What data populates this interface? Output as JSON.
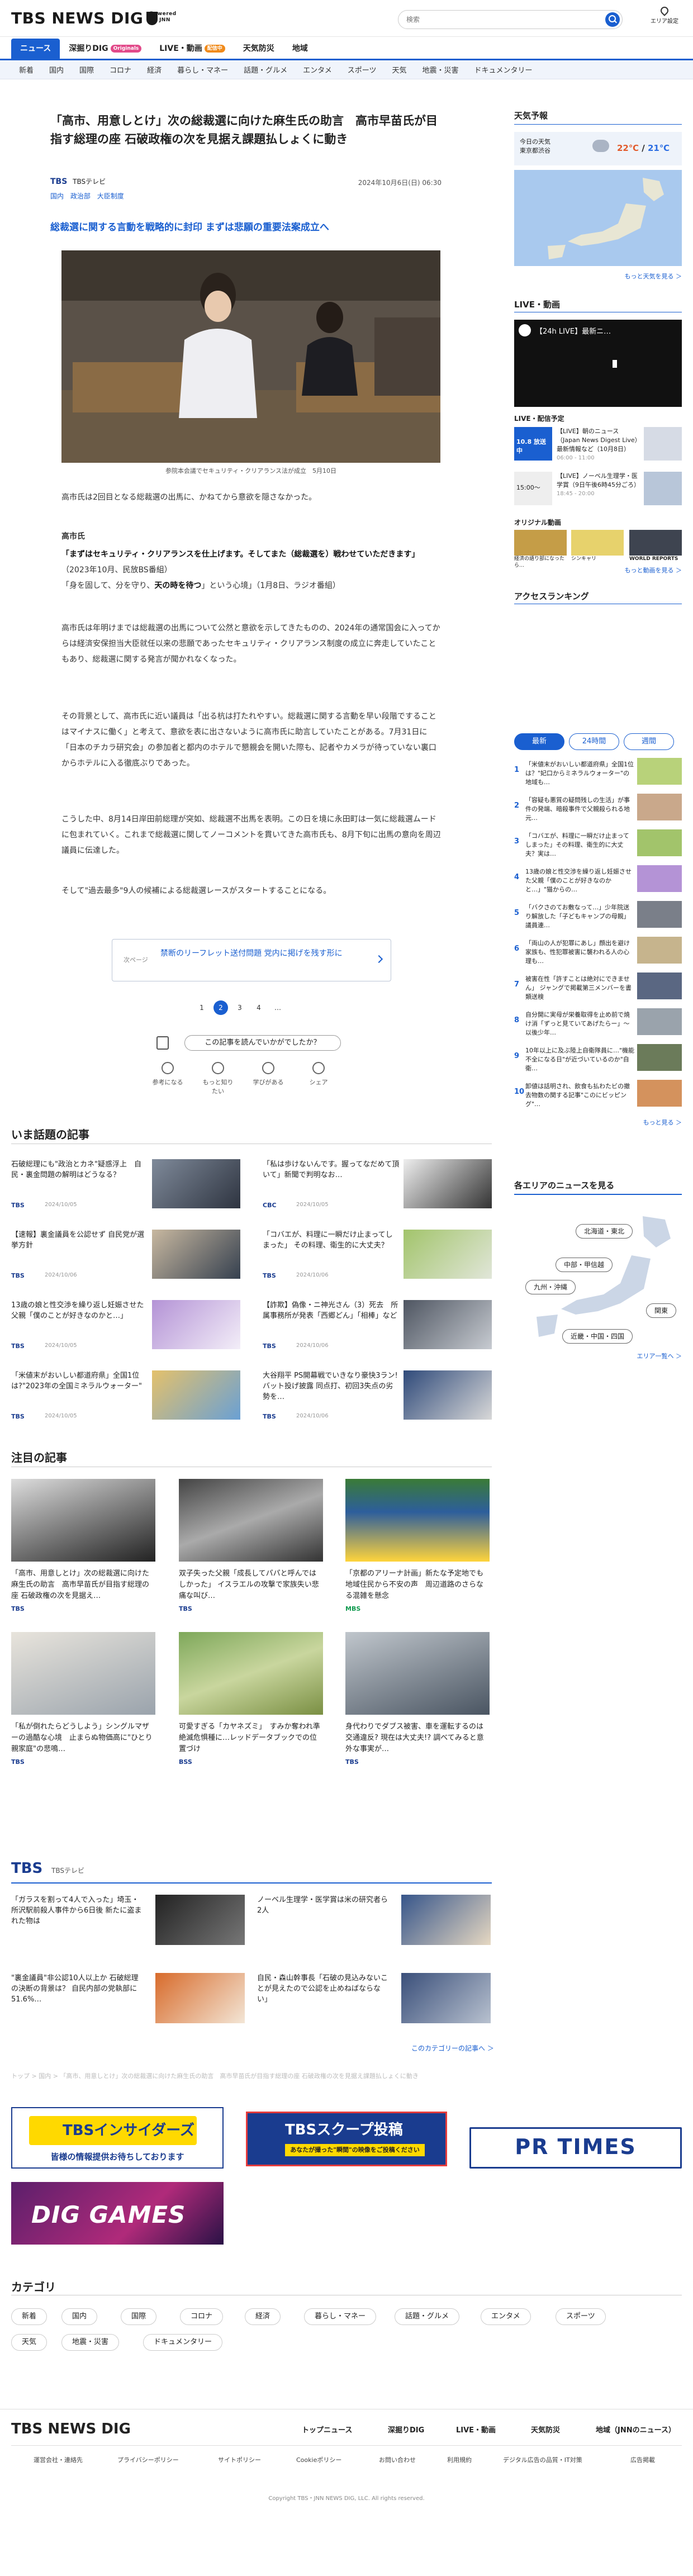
{
  "header": {
    "logo_text": "TBS NEWS DIG",
    "powered_1": "Powered",
    "powered_2": "by JNN",
    "search_placeholder": "検索",
    "area_label": "エリア設定"
  },
  "nav_primary": [
    {
      "label": "ニュース",
      "active": true
    },
    {
      "label": "深掘りDIG",
      "badge": "Originals",
      "badge_color": "#e24a8a"
    },
    {
      "label": "LIVE・動画",
      "badge": "配信中",
      "badge_color": "#f08a1a"
    },
    {
      "label": "天気防災"
    },
    {
      "label": "地域"
    }
  ],
  "nav_secondary": [
    "新着",
    "国内",
    "国際",
    "コロナ",
    "経済",
    "暮らし・マネー",
    "話題・グルメ",
    "エンタメ",
    "スポーツ",
    "天気",
    "地震・災害",
    "ドキュメンタリー"
  ],
  "article": {
    "title": "「高市、用意しとけ」次の総裁選に向けた麻生氏の助言　高市早苗氏が目指す総理の座 石破政権の次を見据え課題払しょくに動き",
    "source": "TBS",
    "source_sub": "TBSテレビ",
    "date": "2024年10月6日(日) 06:30",
    "tags": [
      "国内",
      "政治部",
      "大臣制度"
    ],
    "lead": "総裁選に関する言動を戦略的に封印 まずは悲願の重要法案成立へ",
    "caption": "参院本会議でセキュリティ・クリアランス法が成立　5月10日",
    "p1": "高市氏は2回目となる総裁選の出馬に、かねてから意欲を隠さなかった。",
    "speaker": "高市氏",
    "q1a": "「まずはセキュリティ・クリアランスを仕上げます。そしてまた（総裁選を）戦わせていただきます」",
    "q1b": "（2023年10月、民放BS番組）",
    "q2a": "「身を固して、分を守り、",
    "q2b": "天の時を待つ",
    "q2c": "」という心境」（1月8日、ラジオ番組）",
    "p3": "高市氏は年明けまでは総裁選の出馬について公然と意欲を示してきたものの、2024年の通常国会に入ってからは経済安保担当大臣就任以来の悲願であったセキュリティ・クリアランス制度の成立に奔走していたこともあり、総裁選に関する発言が聞かれなくなった。",
    "p4": "その背景として、高市氏に近い議員は「出る杭は打たれやすい。総裁選に関する言動を早い段階ですることはマイナスに働く」と考えて、意欲を表に出さないように高市氏に助言していたことがある。7月31日に「日本のチカラ研究会」の参加者と都内のホテルで懇親会を開いた際も、記者やカメラが待っていない裏口からホテルに入る徹底ぶりであった。",
    "p5": "こうした中、8月14日岸田前総理が突如、総裁選不出馬を表明。この日を境に永田町は一気に総裁選ムードに包まれていく。これまで総裁選に関してノーコメントを貫いてきた高市氏も、8月下旬に出馬の意向を周辺議員に伝達した。",
    "p6": "そして\"過去最多\"9人の候補による総裁選レースがスタートすることになる。",
    "promo_label": "次ページ",
    "promo_text": "禁断のリーフレット送付問題 党内に掲げを残す形に",
    "pages": [
      "1",
      "2",
      "3",
      "4",
      "…"
    ],
    "feedback_q": "この記事を読んでいかがでしたか？",
    "feedback_opts": [
      "参考になる",
      "もっと知りたい",
      "学びがある",
      "シェア"
    ]
  },
  "hot": {
    "title": "いま話題の記事",
    "items": [
      {
        "text": "石破総理にも\"政治とカネ\"疑惑浮上　自民・裏金問題の解明はどうなる？",
        "src": "TBS",
        "date": "2024/10/05"
      },
      {
        "text": "「私は歩けないんです。握ってなだめて頂いて」新聞で判明なお…",
        "src": "CBC",
        "date": "2024/10/05"
      },
      {
        "text": "【速報】裏金議員を公認せず 自民党が選挙方針",
        "src": "TBS",
        "date": "2024/10/06"
      },
      {
        "text": "「コバエが、料理に一瞬だけ止まってしまった」 その料理、衛生的に大丈夫？",
        "src": "TBS",
        "date": "2024/10/06"
      },
      {
        "text": "13歳の娘と性交渉を繰り返し妊娠させた父親「僕のことが好きなのかと…」",
        "src": "TBS",
        "date": "2024/10/05"
      },
      {
        "text": "【詐欺】偽像・ニ神光さん（3）死去　所属事務所が発表「西郷どん」「相棒」など",
        "src": "TBS",
        "date": "2024/10/06"
      },
      {
        "text": "「米値末がおいしい都道府県」全国1位は?\"2023年の全国ミネラルウォーター\"",
        "src": "TBS",
        "date": "2024/10/05"
      },
      {
        "text": "大谷翔平 PS開幕戦でいきなり豪快3ラン! バット投げ披露 同点打、初回3失点の劣勢を…",
        "src": "TBS",
        "date": "2024/10/06"
      }
    ]
  },
  "featured": {
    "title": "注目の記事",
    "items": [
      {
        "text": "「高市、用意しとけ」次の総裁選に向けた麻生氏の助言　高市早苗氏が目指す総理の座 石破政権の次を見据え…",
        "src": "TBS"
      },
      {
        "text": "双子失った父親「成長してパパと呼んではしかった」 イスラエルの攻撃で家族失い悲痛な叫び…",
        "src": "TBS"
      },
      {
        "text": "「京都のアリーナ計画」新たな予定地でも地域住民から不安の声　周辺道路のさらなる混雑を懸念",
        "src": "MBS"
      },
      {
        "text": "「私が倒れたらどうしよう」シングルマザーの過酷な心境　止まらぬ物価高に\"ひとり親家庭\"の悲鳴…",
        "src": "TBS"
      },
      {
        "text": "可愛すぎる「カヤネズミ」　すみか奪われ準絶滅危惧種に…レッドデータブックでの位置づけ",
        "src": "BSS"
      },
      {
        "text": "身代わりでダブス被害、車を運転するのは交通違反? 現在は大丈夫!? 調べてみると意外な事実が…",
        "src": "TBS"
      }
    ]
  },
  "tbs": {
    "title": "TBS",
    "sub": "TBSテレビ",
    "items": [
      {
        "text": "「ガラスを割って4人で入った」埼玉・所沢駅前殺人事件から6日後 新たに盗まれた物は"
      },
      {
        "text": "ノーベル生理学・医学賞は米の研究者ら2人"
      },
      {
        "text": "\"裏金議員\"非公認10人以上か 石破総理の決断の背景は？ 自民内部の党執部に51.6%…"
      },
      {
        "text": "自民・森山幹事長「石破の見込みないことが見えたので公認を止めねばならない」"
      }
    ],
    "more": "このカテゴリーの記事へ ＞"
  },
  "breadcrumb": "トップ > 国内 > 「高市、用意しとけ」次の総裁選に向けた麻生氏の助言　高市早苗氏が目指す総理の座 石破政権の次を見据え課題払しょくに動き",
  "banners": {
    "insiders": "TBSインサイダーズ",
    "insiders_sub": "皆様の情報提供お待ちしております",
    "scoop": "TBSスクープ投稿",
    "scoop_sub": "あなたが撮った\"瞬間\"の映像をご投稿ください",
    "prtimes": "PR TIMES",
    "diggames": "DIG GAMES"
  },
  "categories": {
    "title": "カテゴリ",
    "items": [
      "新着",
      "国内",
      "国際",
      "コロナ",
      "経済",
      "暮らし・マネー",
      "話題・グルメ",
      "エンタメ",
      "スポーツ",
      "天気",
      "地震・災害",
      "ドキュメンタリー"
    ]
  },
  "right": {
    "weather_title": "天気予報",
    "weather_today": "今日の天気",
    "weather_city": "東京都渋谷",
    "weather_high": "22℃",
    "weather_low": "21℃",
    "weather_more": "もっと天気を見る ＞",
    "live_title": "LIVE・動画",
    "live_video": "【24h LIVE】最新ニ…",
    "schedule_title": "LIVE・配信予定",
    "schedule": [
      {
        "time": "10.8 放送中",
        "text": "【LIVE】朝のニュース（Japan News Digest Live）最新情報など（10月8日）",
        "meta": "06:00 - 11:00"
      },
      {
        "time": "15:00〜",
        "text": "【LIVE】ノーベル生理学・医学賞（9日午後6時45分ごろ）",
        "meta": "18:45 - 20:00"
      }
    ],
    "orig_title": "オリジナル動画",
    "orig": [
      "経済の語り部になったら…",
      "シンキャリ",
      "WORLD REPORTS"
    ],
    "orig_more": "もっと動画を見る ＞",
    "rank_title": "アクセスランキング",
    "rank_tabs": [
      "最新",
      "24時間",
      "週間"
    ],
    "ranking": [
      "「米値末がおいしい都道府県」全国1位は？\"妃口からミネラルウォーター\"の地域も…",
      "「容疑も悪質の疑問残しの生活」が事件の発端、暗殺事件で父親殺られる地元…",
      "「コバエが、料理に一瞬だけ止まってしまった」その料理、衛生的に大丈夫？実は…",
      "13歳の娘と性交渉を繰り返し妊娠させた父親「僕のことが好きなのかと…」\"猫からの…",
      "「バクさのてお敷なって…」少年院送り解放した「子どもキャンプの母親」議員連…",
      "「両山の人が犯罪にあし」顔出を避け家族も、性犯罪被害に襲われる人の心理も…",
      "被害在性「許すことは絶対にできません」 ジャングで掲載第三メンバーを書類送検",
      "自分開に実母が栄養取得を止め前で焼け消「ずっと見ていてあげたらー」〜以後少年…",
      "10年以上に及ぶ陸上自衛隊員に…\"機能不全になる日\"が近づいているのか\"自衛…",
      "卸値は話明され、飲食も払わたビの撤去物数の関する記事\"このにビッピング\"…"
    ],
    "rank_more": "もっと見る ＞",
    "area_title": "各エリアのニュースを見る",
    "areas": [
      "北海道・東北",
      "中部・甲信越",
      "九州・沖縄",
      "関東",
      "近畿・中国・四国"
    ],
    "area_more": "エリア一覧へ ＞"
  },
  "footer": {
    "nav": [
      "トップニュース",
      "深掘りDIG",
      "LIVE・動画",
      "天気防災",
      "地域（JNNのニュース）"
    ],
    "links": [
      "運営会社・連絡先",
      "プライバシーポリシー",
      "サイトポリシー",
      "Cookieポリシー",
      "お問い合わせ",
      "利用規約",
      "デジタル広告の品質・IT対策",
      "広告掲載"
    ],
    "copyright": "Copyright TBS・JNN NEWS DIG, LLC. All rights reserved."
  }
}
